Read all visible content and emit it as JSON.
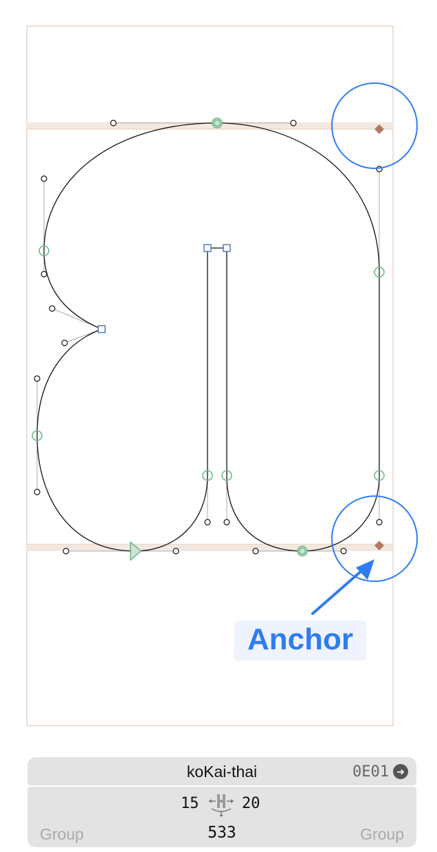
{
  "callout": {
    "label": "Anchor"
  },
  "glyph_info": {
    "name": "koKai-thai",
    "unicode": "0E01",
    "left_sidebearing": "15",
    "right_sidebearing": "20",
    "width": "533",
    "left_group": "Group",
    "right_group": "Group"
  },
  "icons": {
    "goto_glyph": "arrow-right-circle-icon",
    "metrics": "metrics-keys-icon"
  },
  "colors": {
    "anchor": "#b07a5e",
    "highlight": "#2f7cf0",
    "node": "#6fb88a",
    "corner_node": "#4a6fb5",
    "metric_band": "#f3e8e0",
    "info_bar": "#e3e3e3"
  }
}
